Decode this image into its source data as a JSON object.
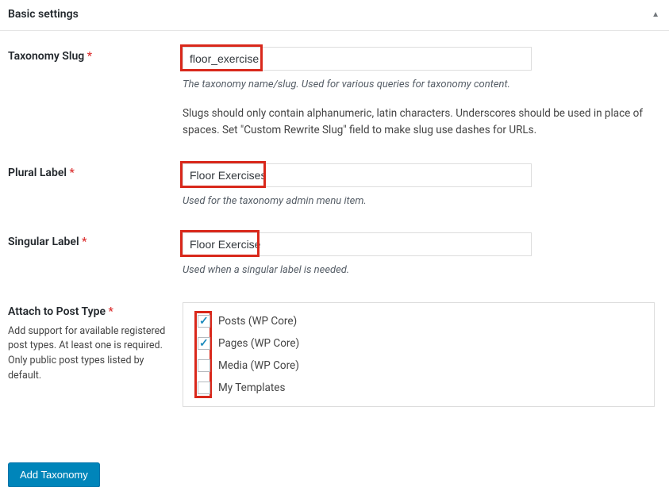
{
  "panel": {
    "title": "Basic settings"
  },
  "fields": {
    "slug": {
      "label": "Taxonomy Slug",
      "value": "floor_exercise",
      "desc1": "The taxonomy name/slug. Used for various queries for taxonomy content.",
      "desc2": "Slugs should only contain alphanumeric, latin characters. Underscores should be used in place of spaces. Set \"Custom Rewrite Slug\" field to make slug use dashes for URLs."
    },
    "plural": {
      "label": "Plural Label",
      "value": "Floor Exercises",
      "desc": "Used for the taxonomy admin menu item."
    },
    "singular": {
      "label": "Singular Label",
      "value": "Floor Exercise",
      "desc": "Used when a singular label is needed."
    },
    "posttype": {
      "label": "Attach to Post Type",
      "subdesc": "Add support for available registered post types. At least one is required. Only public post types listed by default.",
      "options": [
        {
          "label": "Posts (WP Core)",
          "checked": true
        },
        {
          "label": "Pages (WP Core)",
          "checked": true
        },
        {
          "label": "Media (WP Core)",
          "checked": false
        },
        {
          "label": "My Templates",
          "checked": false
        }
      ]
    }
  },
  "submit": {
    "label": "Add Taxonomy"
  },
  "required_marker": "*"
}
